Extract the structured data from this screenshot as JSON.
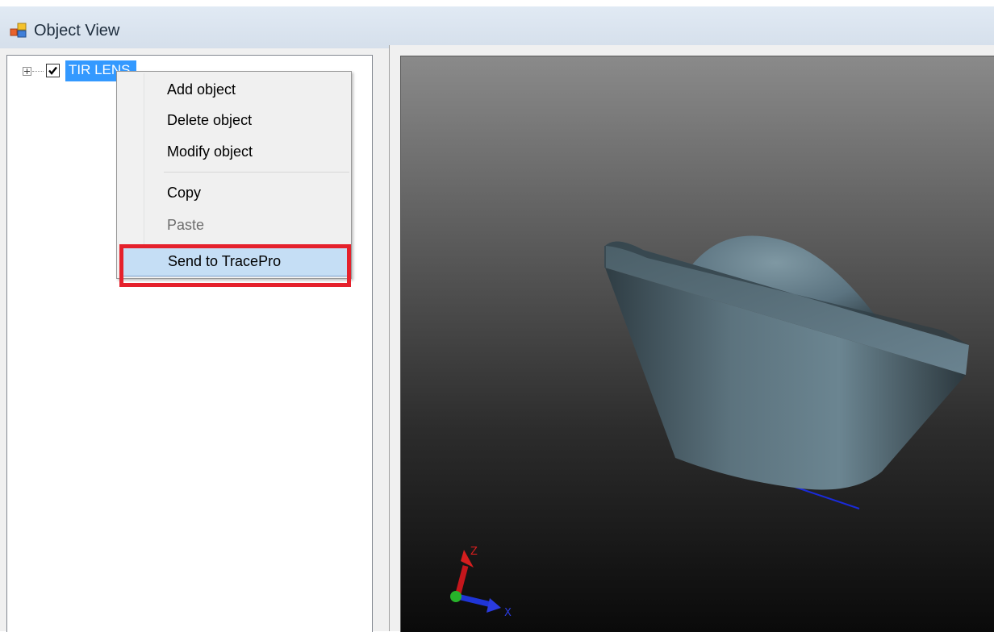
{
  "window": {
    "title": "Object View",
    "icon": "object-view-icon"
  },
  "tree": {
    "nodes": [
      {
        "label": "TIR LENS",
        "checked": true,
        "expanded": false,
        "selected": true
      }
    ]
  },
  "context_menu": {
    "items": [
      {
        "label": "Add object",
        "enabled": true
      },
      {
        "label": "Delete object",
        "enabled": true
      },
      {
        "label": "Modify object",
        "enabled": true
      },
      {
        "label": "Copy",
        "enabled": true
      },
      {
        "label": "Paste",
        "enabled": false
      },
      {
        "label": "Send to TracePro",
        "enabled": true,
        "hovered": true,
        "annotated": true
      }
    ]
  },
  "viewport": {
    "axes": {
      "z": "Z",
      "x": "X"
    },
    "colors": {
      "background_top": "#8a8a8a",
      "background_bottom": "#0a0a0a",
      "model": "#5f7784"
    }
  },
  "colors": {
    "selection": "#3399ff",
    "annotation": "#e5212c",
    "menu_hover": "#c5def5"
  }
}
